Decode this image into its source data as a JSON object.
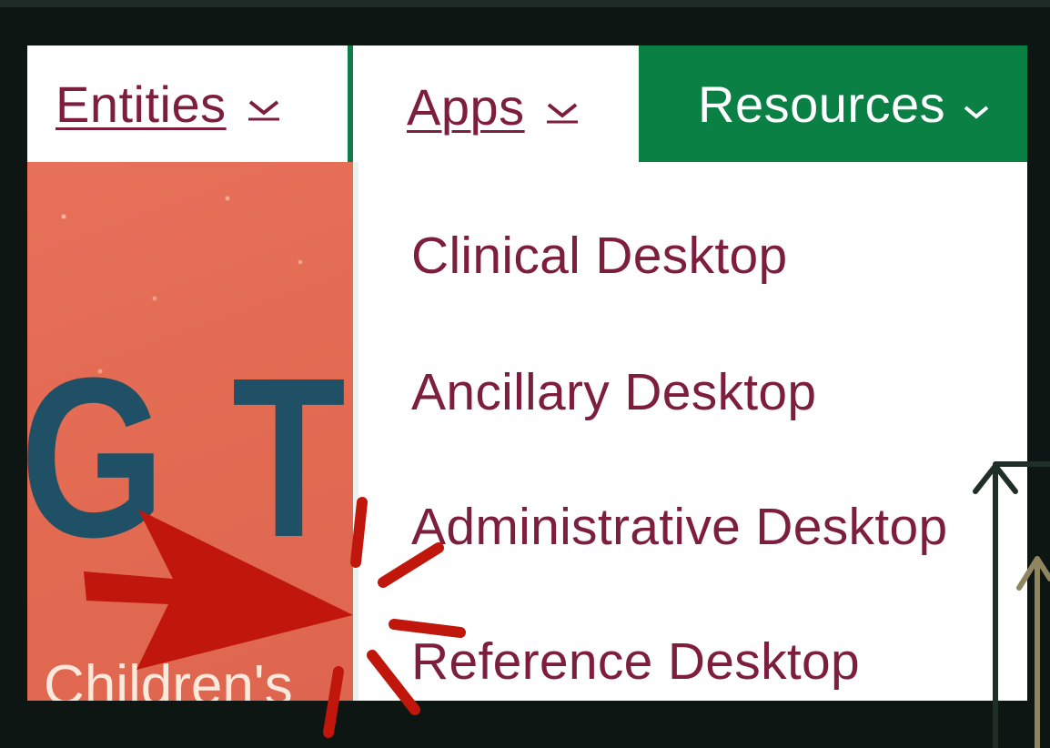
{
  "nav": {
    "entities_label": "Entities",
    "apps_label": "Apps",
    "resources_label": "Resources"
  },
  "hero": {
    "headline": "G TO",
    "subtext": "Children's"
  },
  "apps_menu": {
    "items": [
      {
        "label": "Clinical Desktop"
      },
      {
        "label": "Ancillary Desktop"
      },
      {
        "label": "Administrative Desktop"
      },
      {
        "label": "Reference Desktop"
      }
    ]
  },
  "colors": {
    "link_maroon": "#7d1e3d",
    "nav_green": "#0a8045",
    "hero_coral": "#e36b52",
    "hero_text_navy": "#1f5066",
    "annotation_red": "#c0160c"
  },
  "icons": {
    "chevron": "chevron-down-icon",
    "pointer": "red-arrow-annotation",
    "burst": "highlight-burst-annotation"
  }
}
